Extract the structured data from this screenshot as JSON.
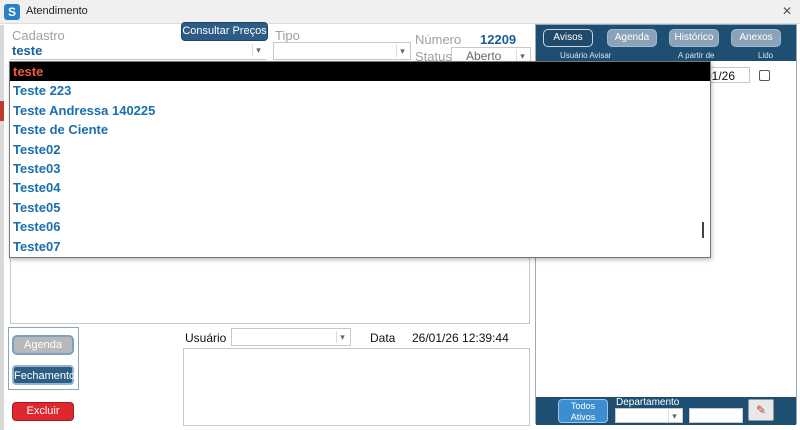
{
  "window": {
    "title": "Atendimento",
    "close_glyph": "✕"
  },
  "form": {
    "cadastro_label": "Cadastro",
    "cadastro_value": "teste",
    "consultar_button": "Consultar Preços",
    "tipo_label": "Tipo",
    "numero_label": "Número",
    "numero_value": "12209",
    "status_label": "Status",
    "status_value": "Aberto",
    "usuario_label": "Usuário",
    "data_label": "Data",
    "data_value": "26/01/26 12:39:44"
  },
  "autocomplete": {
    "items": [
      "teste",
      "Teste 223",
      "Teste Andressa 140225",
      "Teste de Ciente",
      "Teste02",
      "Teste03",
      "Teste04",
      "Teste05",
      "Teste06",
      "Teste07"
    ],
    "selected_index": 0
  },
  "actions": {
    "agenda_button": "Agenda",
    "fechamento_button": "Fechamento",
    "excluir_button": "Excluir"
  },
  "right_panel": {
    "tabs": [
      "Avisos",
      "Agenda",
      "Histórico",
      "Anexos"
    ],
    "active_tab": "Avisos",
    "columns": [
      "Usuário Avisar",
      "A partir de",
      "Lido"
    ],
    "row_date_partial": "01/26",
    "bottom": {
      "todos_ativos_button": "Todos Ativos",
      "departamento_label": "Departamento"
    }
  },
  "colors": {
    "panel_blue": "#1e4f73",
    "link_blue": "#1a6fad",
    "selected_text": "#f05a3c",
    "danger": "#e0272f"
  }
}
